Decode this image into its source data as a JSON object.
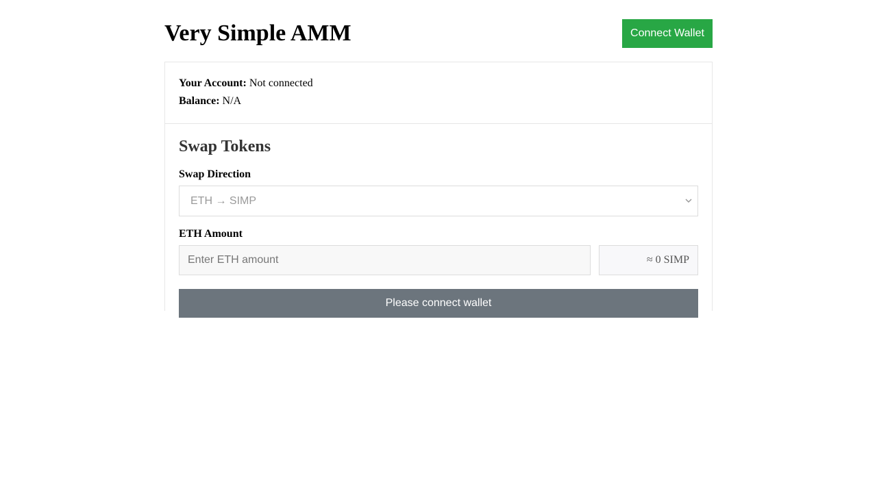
{
  "header": {
    "title": "Very Simple AMM",
    "connect_label": "Connect Wallet"
  },
  "account": {
    "account_label": "Your Account:",
    "account_value": "Not connected",
    "balance_label": "Balance:",
    "balance_value": "N/A"
  },
  "swap": {
    "title": "Swap Tokens",
    "direction_label": "Swap Direction",
    "direction_selected": "ETH → SIMP",
    "amount_label": "ETH Amount",
    "amount_placeholder": "Enter ETH amount",
    "amount_value": "",
    "estimate": "≈ 0 SIMP",
    "action_label": "Please connect wallet"
  },
  "colors": {
    "connect_button": "#28a745",
    "action_button_disabled": "#6c757d",
    "card_border": "#e6e6e6"
  },
  "icons": {
    "select_arrow": "chevron-down-icon"
  }
}
